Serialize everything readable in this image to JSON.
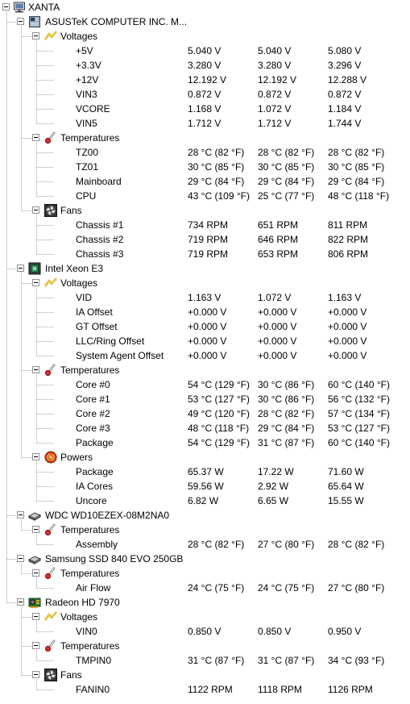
{
  "tree": [
    {
      "kind": "root",
      "icon": "computer",
      "label": "XANTA",
      "children": [
        {
          "kind": "device",
          "icon": "motherboard",
          "label": "ASUSTeK COMPUTER INC. M...",
          "children": [
            {
              "kind": "group",
              "icon": "voltage",
              "label": "Voltages",
              "rows": [
                {
                  "label": "+5V",
                  "values": [
                    "5.040 V",
                    "5.040 V",
                    "5.080 V"
                  ]
                },
                {
                  "label": "+3.3V",
                  "values": [
                    "3.280 V",
                    "3.280 V",
                    "3.296 V"
                  ]
                },
                {
                  "label": "+12V",
                  "values": [
                    "12.192 V",
                    "12.192 V",
                    "12.288 V"
                  ]
                },
                {
                  "label": "VIN3",
                  "values": [
                    "0.872 V",
                    "0.872 V",
                    "0.872 V"
                  ]
                },
                {
                  "label": "VCORE",
                  "values": [
                    "1.168 V",
                    "1.072 V",
                    "1.184 V"
                  ]
                },
                {
                  "label": "VIN5",
                  "values": [
                    "1.712 V",
                    "1.712 V",
                    "1.744 V"
                  ]
                }
              ]
            },
            {
              "kind": "group",
              "icon": "thermometer",
              "label": "Temperatures",
              "rows": [
                {
                  "label": "TZ00",
                  "values": [
                    "28 °C  (82 °F)",
                    "28 °C  (82 °F)",
                    "28 °C  (82 °F)"
                  ]
                },
                {
                  "label": "TZ01",
                  "values": [
                    "30 °C  (85 °F)",
                    "30 °C  (85 °F)",
                    "30 °C  (85 °F)"
                  ]
                },
                {
                  "label": "Mainboard",
                  "values": [
                    "29 °C  (84 °F)",
                    "29 °C  (84 °F)",
                    "29 °C  (84 °F)"
                  ]
                },
                {
                  "label": "CPU",
                  "values": [
                    "43 °C  (109 °F)",
                    "25 °C  (77 °F)",
                    "48 °C  (118 °F)"
                  ]
                }
              ]
            },
            {
              "kind": "group",
              "icon": "fan",
              "label": "Fans",
              "rows": [
                {
                  "label": "Chassis #1",
                  "values": [
                    "734 RPM",
                    "651 RPM",
                    "811 RPM"
                  ]
                },
                {
                  "label": "Chassis #2",
                  "values": [
                    "719 RPM",
                    "646 RPM",
                    "822 RPM"
                  ]
                },
                {
                  "label": "Chassis #3",
                  "values": [
                    "719 RPM",
                    "653 RPM",
                    "806 RPM"
                  ]
                }
              ]
            }
          ]
        },
        {
          "kind": "device",
          "icon": "cpu",
          "label": "Intel Xeon E3",
          "children": [
            {
              "kind": "group",
              "icon": "voltage",
              "label": "Voltages",
              "rows": [
                {
                  "label": "VID",
                  "values": [
                    "1.163 V",
                    "1.072 V",
                    "1.163 V"
                  ]
                },
                {
                  "label": "IA Offset",
                  "values": [
                    "+0.000 V",
                    "+0.000 V",
                    "+0.000 V"
                  ]
                },
                {
                  "label": "GT Offset",
                  "values": [
                    "+0.000 V",
                    "+0.000 V",
                    "+0.000 V"
                  ]
                },
                {
                  "label": "LLC/Ring Offset",
                  "values": [
                    "+0.000 V",
                    "+0.000 V",
                    "+0.000 V"
                  ]
                },
                {
                  "label": "System Agent Offset",
                  "values": [
                    "+0.000 V",
                    "+0.000 V",
                    "+0.000 V"
                  ]
                }
              ]
            },
            {
              "kind": "group",
              "icon": "thermometer",
              "label": "Temperatures",
              "rows": [
                {
                  "label": "Core #0",
                  "values": [
                    "54 °C  (129 °F)",
                    "30 °C  (86 °F)",
                    "60 °C  (140 °F)"
                  ]
                },
                {
                  "label": "Core #1",
                  "values": [
                    "53 °C  (127 °F)",
                    "30 °C  (86 °F)",
                    "56 °C  (132 °F)"
                  ]
                },
                {
                  "label": "Core #2",
                  "values": [
                    "49 °C  (120 °F)",
                    "28 °C  (82 °F)",
                    "57 °C  (134 °F)"
                  ]
                },
                {
                  "label": "Core #3",
                  "values": [
                    "48 °C  (118 °F)",
                    "29 °C  (84 °F)",
                    "53 °C  (127 °F)"
                  ]
                },
                {
                  "label": "Package",
                  "values": [
                    "54 °C  (129 °F)",
                    "31 °C  (87 °F)",
                    "60 °C  (140 °F)"
                  ]
                }
              ]
            },
            {
              "kind": "group",
              "icon": "power",
              "label": "Powers",
              "rows": [
                {
                  "label": "Package",
                  "values": [
                    "65.37 W",
                    "17.22 W",
                    "71.60 W"
                  ]
                },
                {
                  "label": "IA Cores",
                  "values": [
                    "59.56 W",
                    "2.92 W",
                    "65.64 W"
                  ]
                },
                {
                  "label": "Uncore",
                  "values": [
                    "6.82 W",
                    "6.65 W",
                    "15.55 W"
                  ]
                }
              ]
            }
          ]
        },
        {
          "kind": "device",
          "icon": "hdd",
          "label": "WDC WD10EZEX-08M2NA0",
          "children": [
            {
              "kind": "group",
              "icon": "thermometer",
              "label": "Temperatures",
              "rows": [
                {
                  "label": "Assembly",
                  "values": [
                    "28 °C  (82 °F)",
                    "27 °C  (80 °F)",
                    "28 °C  (82 °F)"
                  ]
                }
              ]
            }
          ]
        },
        {
          "kind": "device",
          "icon": "hdd",
          "label": "Samsung SSD 840 EVO 250GB",
          "children": [
            {
              "kind": "group",
              "icon": "thermometer",
              "label": "Temperatures",
              "rows": [
                {
                  "label": "Air Flow",
                  "values": [
                    "24 °C  (75 °F)",
                    "24 °C  (75 °F)",
                    "27 °C  (80 °F)"
                  ]
                }
              ]
            }
          ]
        },
        {
          "kind": "device",
          "icon": "gpu",
          "label": "Radeon HD 7970",
          "children": [
            {
              "kind": "group",
              "icon": "voltage",
              "label": "Voltages",
              "rows": [
                {
                  "label": "VIN0",
                  "values": [
                    "0.850 V",
                    "0.850 V",
                    "0.950 V"
                  ]
                }
              ]
            },
            {
              "kind": "group",
              "icon": "thermometer",
              "label": "Temperatures",
              "rows": [
                {
                  "label": "TMPIN0",
                  "values": [
                    "31 °C  (87 °F)",
                    "31 °C  (87 °F)",
                    "34 °C  (93 °F)"
                  ]
                }
              ]
            },
            {
              "kind": "group",
              "icon": "fan",
              "label": "Fans",
              "rows": [
                {
                  "label": "FANIN0",
                  "values": [
                    "1122 RPM",
                    "1118 RPM",
                    "1126 RPM"
                  ]
                }
              ]
            }
          ]
        }
      ]
    }
  ]
}
